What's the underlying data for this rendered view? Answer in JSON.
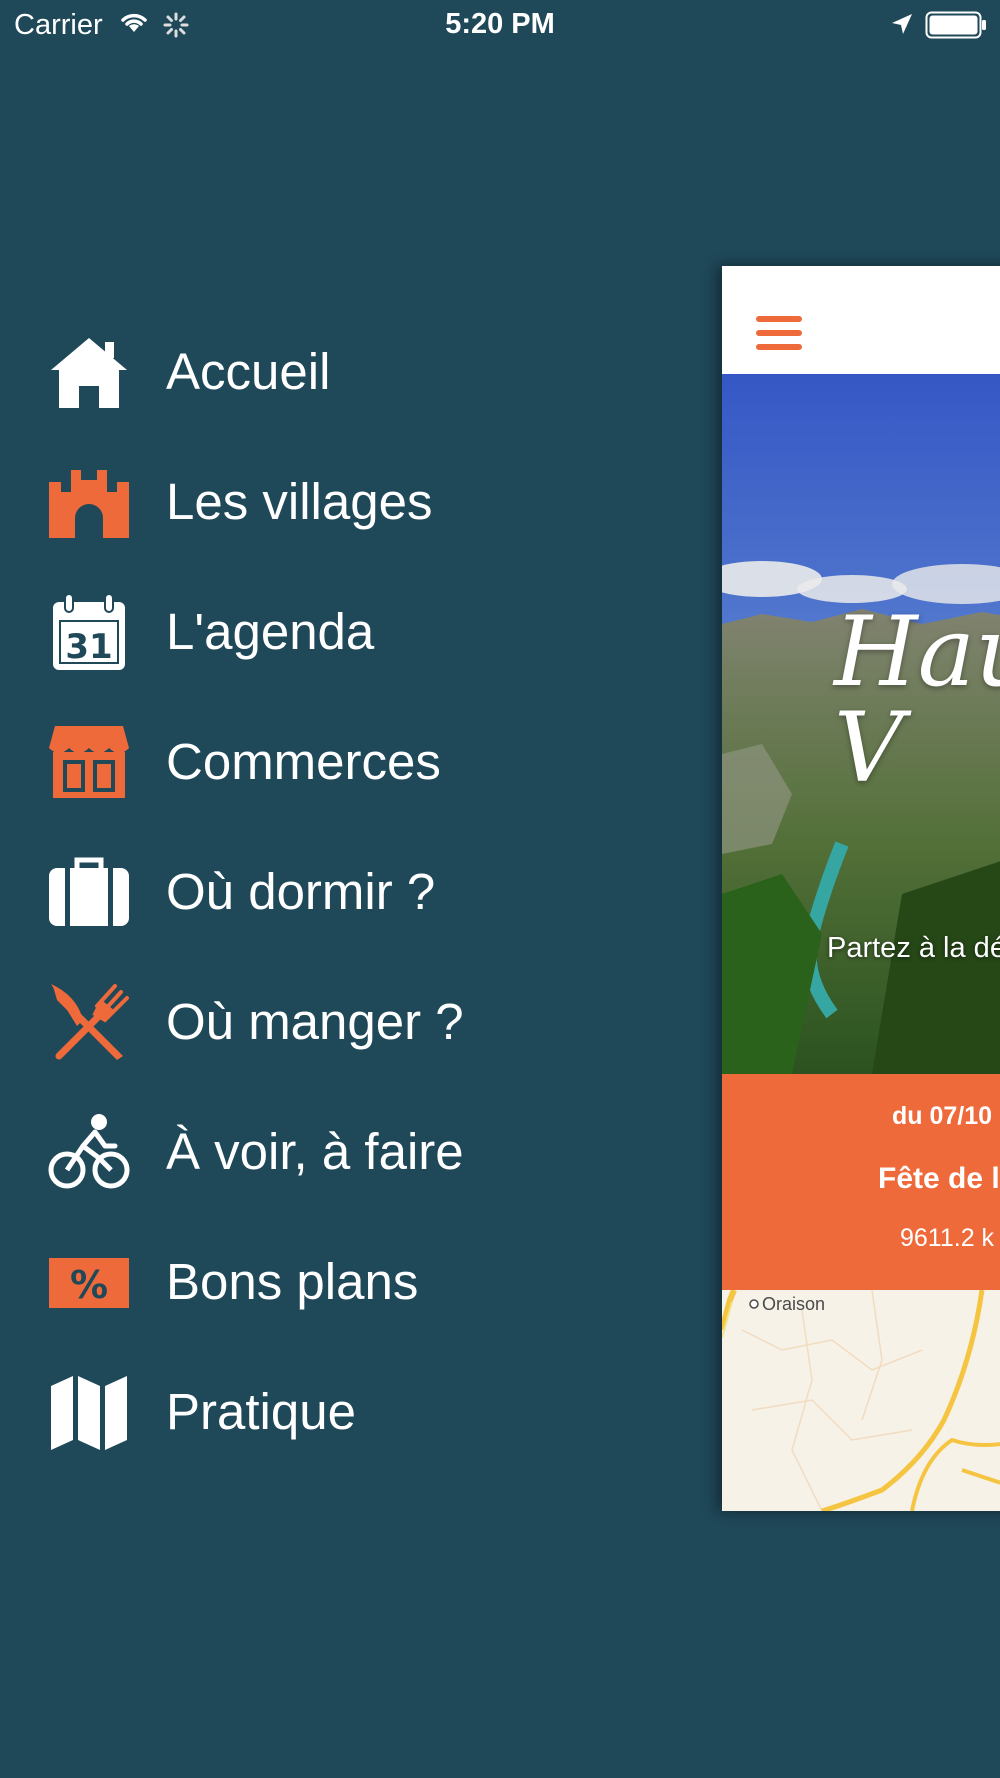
{
  "status_bar": {
    "carrier": "Carrier",
    "time": "5:20 PM"
  },
  "menu": {
    "items": [
      {
        "label": "Accueil",
        "icon": "home-icon",
        "icon_color": "#ffffff"
      },
      {
        "label": "Les villages",
        "icon": "castle-icon",
        "icon_color": "#ef6a3a"
      },
      {
        "label": "L'agenda",
        "icon": "calendar-icon",
        "icon_color": "#ffffff",
        "icon_text": "31"
      },
      {
        "label": "Commerces",
        "icon": "shop-icon",
        "icon_color": "#ef6a3a"
      },
      {
        "label": "Où dormir ?",
        "icon": "suitcase-icon",
        "icon_color": "#ffffff"
      },
      {
        "label": "Où manger ?",
        "icon": "fork-knife-icon",
        "icon_color": "#ef6a3a"
      },
      {
        "label": "À voir, à faire",
        "icon": "cyclist-icon",
        "icon_color": "#ffffff"
      },
      {
        "label": "Bons plans",
        "icon": "percent-icon",
        "icon_color": "#ef6a3a",
        "icon_text": "%"
      },
      {
        "label": "Pratique",
        "icon": "map-icon",
        "icon_color": "#ffffff"
      }
    ]
  },
  "main": {
    "hero": {
      "title": "Hau\nV",
      "subtitle": "Partez à la dé"
    },
    "event": {
      "date": "du 07/10",
      "title": "Fête de l",
      "distance": "9611.2 k"
    },
    "map": {
      "place_label": "Oraison"
    }
  },
  "colors": {
    "background": "#1f4859",
    "accent": "#ef6a3a",
    "text": "#ffffff"
  }
}
